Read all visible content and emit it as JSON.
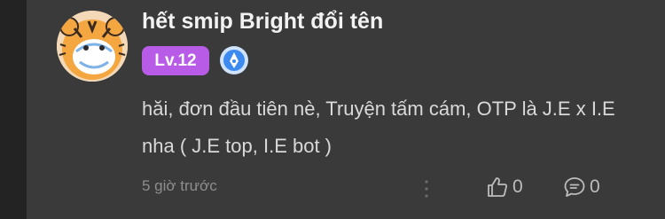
{
  "comment": {
    "username": "hết smip Bright đổi tên",
    "level": "Lv.12",
    "text": "hăi, đơn đầu tiên nè, Truyện tấm cám, OTP là J.E x I.E nha ( J.E top, I.E bot )",
    "timestamp": "5 giờ trước",
    "likes": "0",
    "replies": "0"
  },
  "icons": {
    "avatar": "tiger-avatar",
    "rank": "blue-pen-badge-icon",
    "more": "vertical-dots-icon",
    "like": "thumbs-up-icon",
    "reply": "speech-bubble-icon"
  },
  "colors": {
    "background": "#3a3a3a",
    "outer_background": "#232323",
    "level_badge": "#b85ce8",
    "rank_badge": "#3d8bf0"
  }
}
